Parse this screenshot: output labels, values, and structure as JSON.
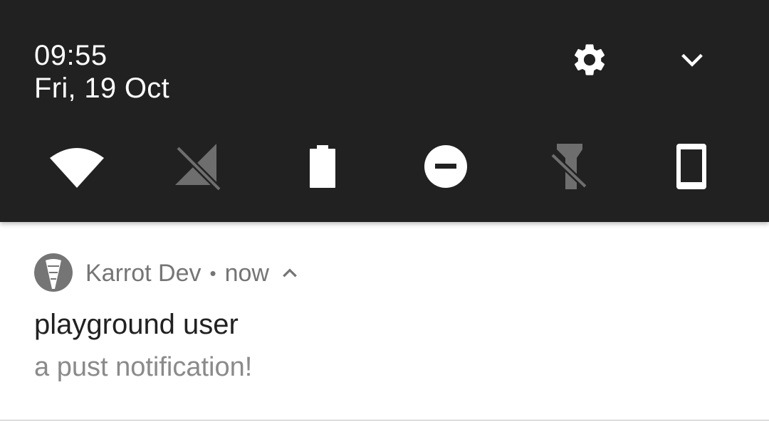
{
  "status_header": {
    "time": "09:55",
    "date": "Fri, 19 Oct",
    "settings_icon": "gear-icon",
    "expand_icon": "chevron-down-icon"
  },
  "quick_settings": [
    {
      "icon": "wifi-icon",
      "state": "on"
    },
    {
      "icon": "cellular-off-icon",
      "state": "off"
    },
    {
      "icon": "battery-icon",
      "state": "on"
    },
    {
      "icon": "do-not-disturb-icon",
      "state": "on"
    },
    {
      "icon": "flashlight-off-icon",
      "state": "off"
    },
    {
      "icon": "portrait-rotation-icon",
      "state": "on"
    }
  ],
  "notification": {
    "app_name": "Karrot Dev",
    "separator": "•",
    "time": "now",
    "title": "playground user",
    "text": "a pust notification!"
  },
  "colors": {
    "shade_background": "#212121",
    "active_icon": "#ffffff",
    "inactive_icon": "#6e6e6e",
    "secondary_text": "#757575"
  }
}
